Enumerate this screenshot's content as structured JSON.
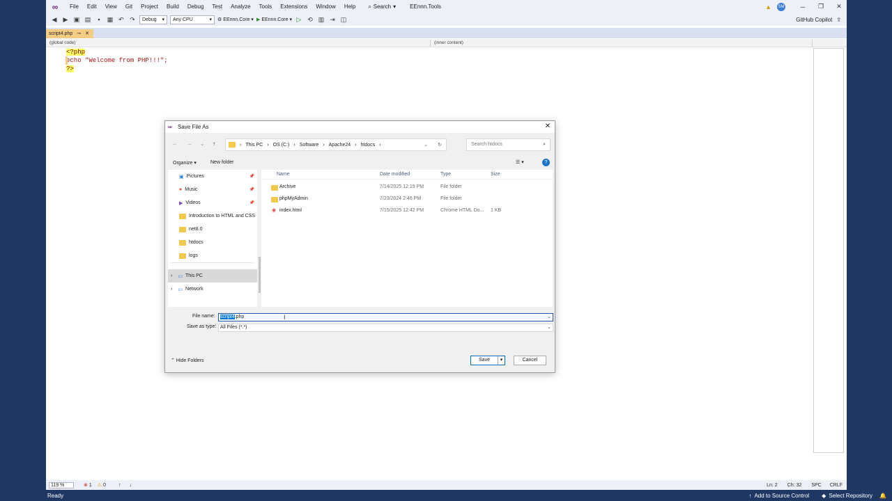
{
  "menubar": {
    "items": [
      "File",
      "Edit",
      "View",
      "Git",
      "Project",
      "Build",
      "Debug",
      "Test",
      "Analyze",
      "Tools",
      "Extensions",
      "Window",
      "Help"
    ],
    "search_label": "Search",
    "solution_name": "EEnnn.Tools",
    "avatar_initials": "SM"
  },
  "toolbar": {
    "config": "Debug",
    "platform": "Any CPU",
    "startup_project": "EEnnn.Core",
    "run_label": "EEnnn.Core",
    "copilot_label": "GitHub Copilot"
  },
  "tabs": {
    "active": "script4.php"
  },
  "navbar": {
    "left": "(global code)",
    "right": "(inner content)"
  },
  "editor": {
    "lines": [
      "<?php",
      "echo \"Welcome from PHP!!!\";",
      "?>"
    ]
  },
  "statusbar": {
    "zoom": "119 %",
    "errors": "1",
    "warnings": "0",
    "line": "Ln: 2",
    "col": "Ch: 32",
    "spacing": "SPC",
    "eol": "CRLF",
    "ready": "Ready",
    "source_control": "Add to Source Control",
    "repo": "Select Repository"
  },
  "dialog": {
    "title": "Save File As",
    "breadcrumb": [
      "This PC",
      "OS (C:)",
      "Software",
      "Apache24",
      "htdocs"
    ],
    "search_placeholder": "Search htdocs",
    "organize_label": "Organize",
    "new_folder_label": "New folder",
    "nav_items": [
      {
        "label": "Pictures",
        "pinned": true
      },
      {
        "label": "Music",
        "pinned": true
      },
      {
        "label": "Videos",
        "pinned": true
      },
      {
        "label": "Introduction to HTML and CSS",
        "pinned": false
      },
      {
        "label": "net8.0",
        "pinned": false
      },
      {
        "label": "htdocs",
        "pinned": false
      },
      {
        "label": "logs",
        "pinned": false
      }
    ],
    "nav_tree": [
      "This PC",
      "Network"
    ],
    "columns": {
      "name": "Name",
      "date": "Date modified",
      "type": "Type",
      "size": "Size"
    },
    "files": [
      {
        "name": "Archive",
        "date": "7/14/2025 12:19 PM",
        "type": "File folder",
        "size": ""
      },
      {
        "name": "phpMyAdmin",
        "date": "7/23/2024 2:46 PM",
        "type": "File folder",
        "size": ""
      },
      {
        "name": "index.html",
        "date": "7/15/2025 12:42 PM",
        "type": "Chrome HTML Do...",
        "size": "1 KB"
      }
    ],
    "file_name_label": "File name:",
    "file_name_selected": "script4",
    "file_name_rest": ".php",
    "save_type_label": "Save as type:",
    "save_type_value": "All Files (*.*)",
    "hide_folders_label": "Hide Folders",
    "save_label": "Save",
    "cancel_label": "Cancel"
  }
}
